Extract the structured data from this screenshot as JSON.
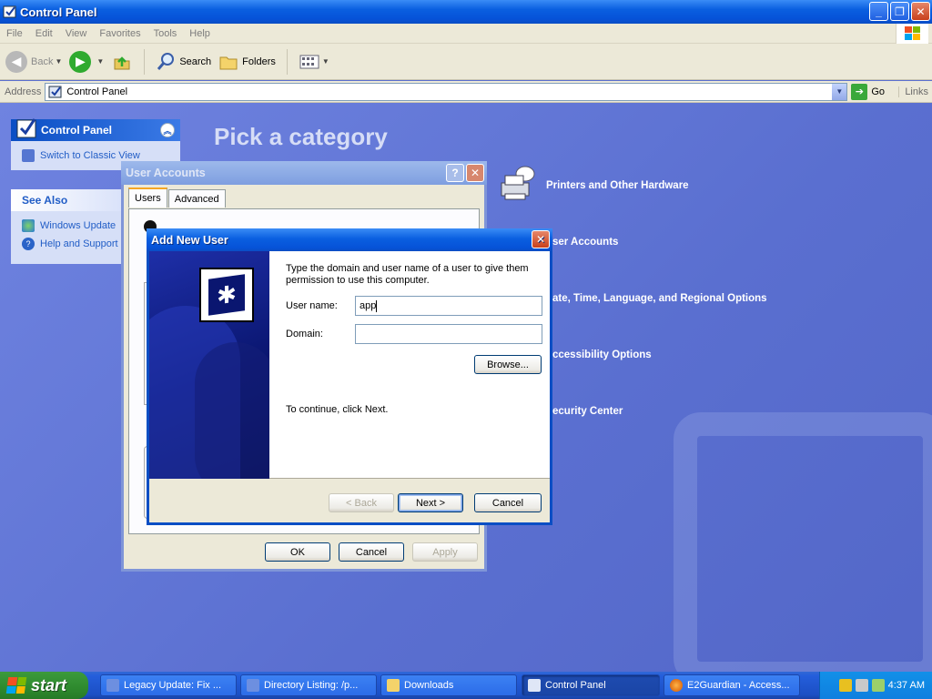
{
  "window": {
    "title": "Control Panel"
  },
  "menu": [
    "File",
    "Edit",
    "View",
    "Favorites",
    "Tools",
    "Help"
  ],
  "toolbar": {
    "back": "Back",
    "search": "Search",
    "folders": "Folders"
  },
  "address": {
    "label": "Address",
    "value": "Control Panel",
    "go": "Go",
    "links": "Links"
  },
  "left_panel": {
    "control_panel": {
      "title": "Control Panel",
      "switch": "Switch to Classic View"
    },
    "see_also": {
      "title": "See Also",
      "items": [
        "Windows Update",
        "Help and Support"
      ]
    }
  },
  "main": {
    "heading": "Pick a category",
    "categories": [
      "Printers and Other Hardware",
      "ser Accounts",
      "ate, Time, Language, and Regional Options",
      "ccessibility Options",
      "ecurity Center"
    ]
  },
  "user_accounts": {
    "title": "User Accounts",
    "tabs": [
      "Users",
      "Advanced"
    ],
    "ok": "OK",
    "cancel": "Cancel",
    "apply": "Apply"
  },
  "add_user": {
    "title": "Add New User",
    "instructions": "Type the domain and user name of a user to give them permission to use this computer.",
    "username_label": "User name:",
    "username_value": "app",
    "domain_label": "Domain:",
    "domain_value": "",
    "browse": "Browse...",
    "continue_text": "To continue, click Next.",
    "back": "< Back",
    "next": "Next >",
    "cancel": "Cancel"
  },
  "taskbar": {
    "start": "start",
    "tasks": [
      "Legacy Update: Fix ...",
      "Directory Listing: /p...",
      "Downloads",
      "Control Panel",
      "E2Guardian - Access..."
    ],
    "clock": "4:37 AM"
  },
  "colors": {
    "xp_blue": "#0a4ec4",
    "start_green": "#2e8a2e",
    "content_bg": "#5a6fd0"
  }
}
